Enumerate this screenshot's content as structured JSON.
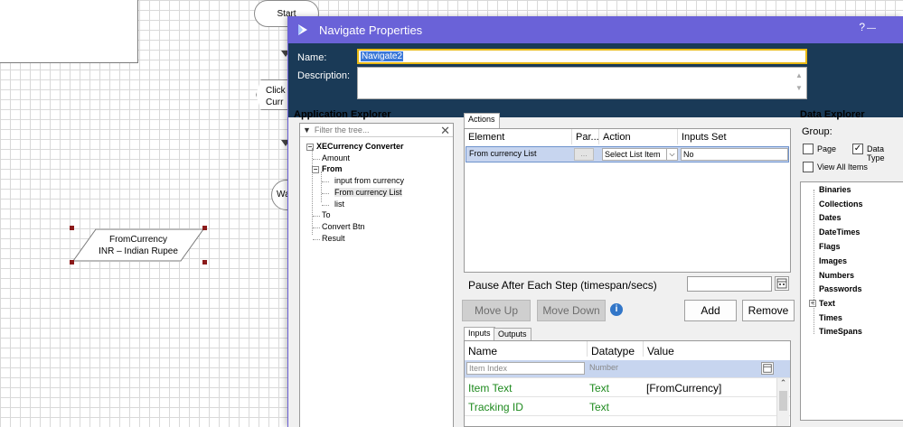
{
  "canvas": {
    "start_label": "Start",
    "click_label": "Click\nCurr",
    "wait_label": "Wa",
    "data_item_lines": [
      "FromCurrency",
      "INR – Indian Rupee"
    ]
  },
  "dialog": {
    "title": "Navigate Properties",
    "help_glyph": "?",
    "minimize_glyph": "—",
    "name_label": "Name:",
    "name_value": "Navigate2",
    "description_label": "Description:",
    "description_value": "",
    "colors": {
      "titlebar": "#6a62d8",
      "header": "#1a3a57",
      "name_focus": "#e9b914"
    }
  },
  "app_explorer": {
    "title": "Application Explorer",
    "filter_placeholder": "Filter the tree...",
    "tree": {
      "root": "XECurrency Converter",
      "amount": "Amount",
      "from": "From",
      "from_children": [
        "input from currency",
        "From currency List",
        "list"
      ],
      "to": "To",
      "convert": "Convert Btn",
      "result": "Result"
    }
  },
  "actions": {
    "tab_label": "Actions",
    "columns": [
      "Element",
      "Par...",
      "Action",
      "Inputs Set"
    ],
    "row": {
      "element": "From currency List",
      "params_button": "...",
      "action": "Select List Item",
      "inputs_set": "No"
    },
    "pause_label": "Pause After Each Step (timespan/secs)",
    "pause_value": "",
    "buttons": {
      "move_up": "Move Up",
      "move_down": "Move Down",
      "add": "Add",
      "remove": "Remove"
    }
  },
  "io": {
    "tabs": [
      "Inputs",
      "Outputs"
    ],
    "columns": [
      "Name",
      "Datatype",
      "Value"
    ],
    "rows": [
      {
        "name": "Item Index",
        "datatype": "Number",
        "value": ""
      },
      {
        "name": "Item Text",
        "datatype": "Text",
        "value": "[FromCurrency]"
      },
      {
        "name": "Tracking ID",
        "datatype": "Text",
        "value": ""
      }
    ]
  },
  "data_explorer": {
    "title": "Data Explorer",
    "group_label": "Group:",
    "checkboxes": {
      "page": "Page",
      "data_type": "Data Type",
      "view_all": "View All Items"
    },
    "items": [
      "Binaries",
      "Collections",
      "Dates",
      "DateTimes",
      "Flags",
      "Images",
      "Numbers",
      "Passwords",
      "Text",
      "Times",
      "TimeSpans"
    ]
  }
}
